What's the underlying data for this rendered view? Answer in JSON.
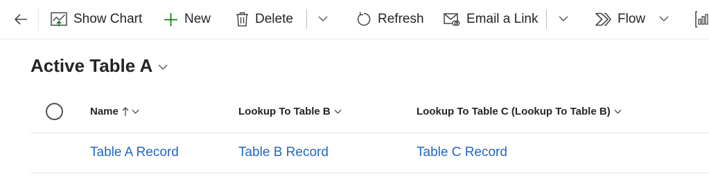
{
  "command_bar": {
    "show_chart": "Show Chart",
    "new": "New",
    "delete": "Delete",
    "refresh": "Refresh",
    "email_link": "Email a Link",
    "flow": "Flow"
  },
  "view": {
    "title": "Active Table A"
  },
  "grid": {
    "columns": [
      {
        "label": "Name"
      },
      {
        "label": "Lookup To Table B"
      },
      {
        "label": "Lookup To Table C (Lookup To Table B)"
      }
    ],
    "rows": [
      {
        "cells": [
          "Table A Record",
          "Table B Record",
          "Table C Record"
        ]
      }
    ]
  },
  "colors": {
    "link": "#2266c2",
    "accent_green": "#107c10",
    "text": "#242424",
    "divider": "#e6e6e6"
  },
  "icons": [
    "back-arrow-icon",
    "chart-icon",
    "plus-icon",
    "trash-icon",
    "chevron-down-icon",
    "refresh-icon",
    "email-link-icon",
    "flow-icon",
    "report-icon",
    "sort-ascending-icon"
  ]
}
